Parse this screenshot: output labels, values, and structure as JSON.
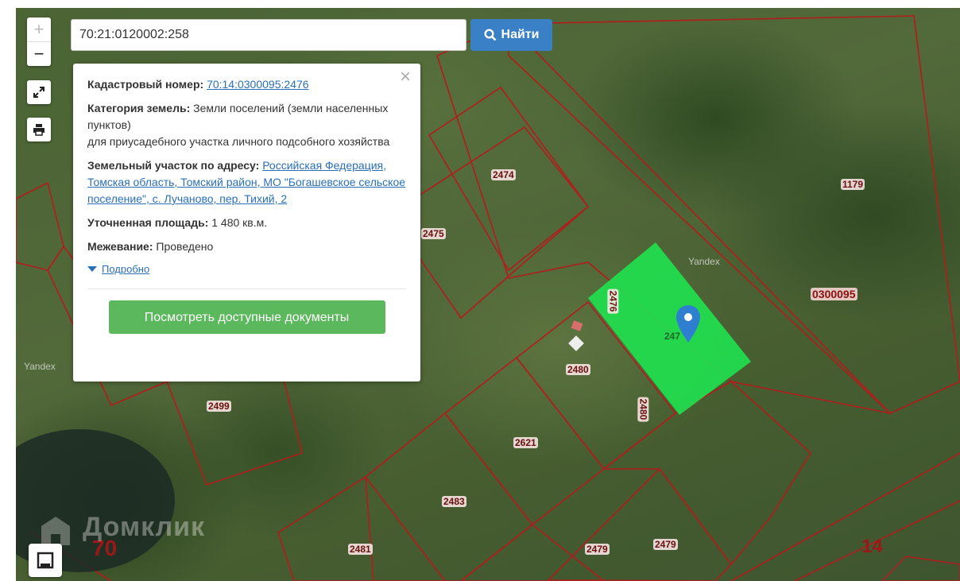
{
  "search": {
    "value": "70:21:0120002:258",
    "button_label": "Найти"
  },
  "controls": {
    "zoom_in": "+",
    "zoom_out": "−"
  },
  "popup": {
    "cadastral_label": "Кадастровый номер:",
    "cadastral_value": "70:14:0300095:2476",
    "category_label": "Категория земель:",
    "category_value_1": "Земли поселений (земли населенных пунктов)",
    "category_value_2": "для приусадебного участка личного подсобного хозяйства",
    "address_label": "Земельный участок по адресу:",
    "address_value": "Российская Федерация, Томская область, Томский район, МО \"Богашевское сельское поселение\", с. Лучаново, пер. Тихий, 2",
    "area_label": "Уточненная площадь:",
    "area_value": "1 480 кв.м.",
    "survey_label": "Межевание:",
    "survey_value": "Проведено",
    "more_label": "Подробно",
    "docs_button": "Посмотреть доступные документы",
    "close": "×"
  },
  "map": {
    "plots": [
      "2474",
      "2475",
      "1179",
      "2476",
      "2480",
      "2480",
      "2499",
      "2621",
      "2483",
      "2481",
      "2479",
      "2479"
    ],
    "quarter": "0300095",
    "region": "70",
    "district": "14",
    "highlight_label": "247",
    "yandex": "Yandex",
    "watermark": "Домклик",
    "colors": {
      "boundary": "#b21c1c",
      "selected": "#21e04e",
      "button": "#3a80c6",
      "docs": "#5cb85c"
    }
  }
}
